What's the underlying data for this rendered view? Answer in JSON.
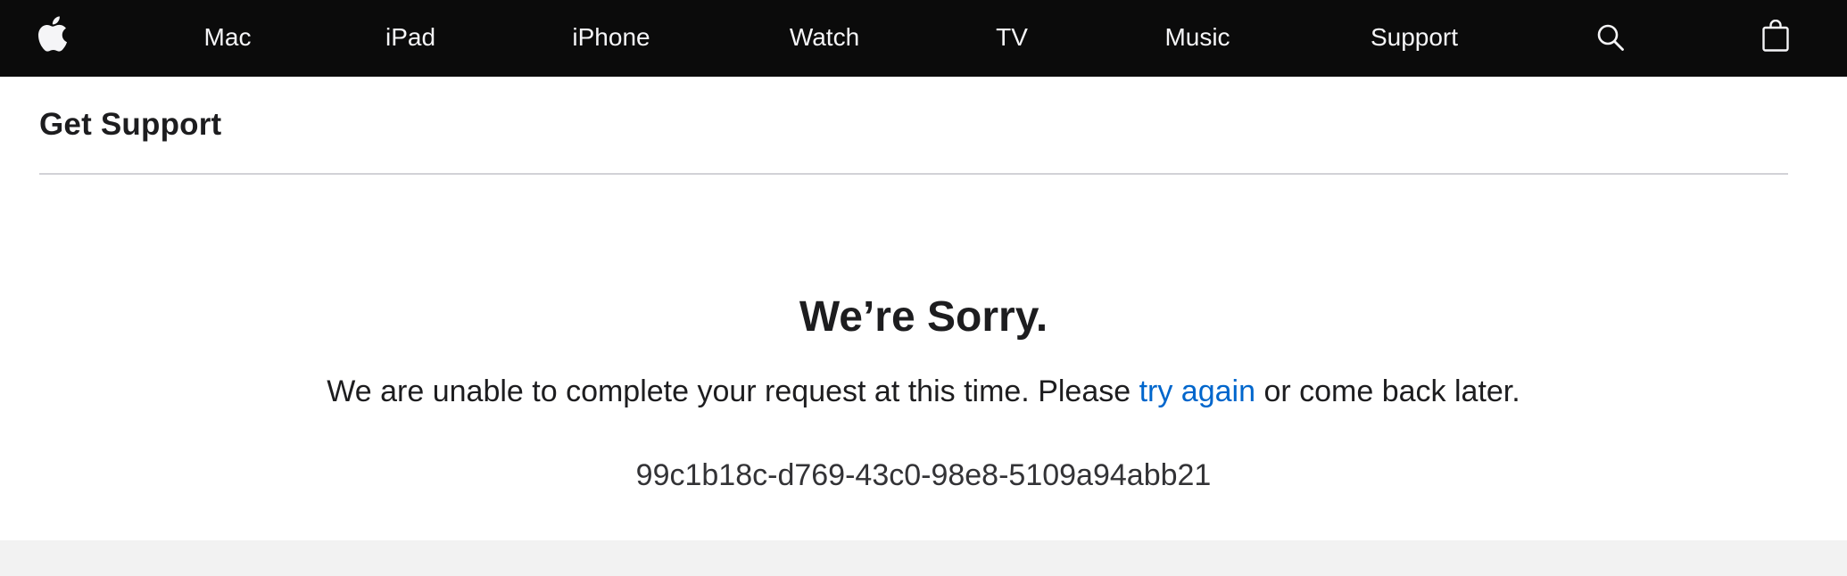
{
  "nav": {
    "items": [
      {
        "label": "Mac"
      },
      {
        "label": "iPad"
      },
      {
        "label": "iPhone"
      },
      {
        "label": "Watch"
      },
      {
        "label": "TV"
      },
      {
        "label": "Music"
      },
      {
        "label": "Support"
      }
    ],
    "icons": [
      "apple-logo-icon",
      "search-icon",
      "bag-icon"
    ],
    "background": "#0b0b0b",
    "text_color": "#f5f5f7"
  },
  "subnav": {
    "title": "Get Support"
  },
  "error": {
    "heading": "We’re Sorry.",
    "message_before": "We are unable to complete your request at this time. Please ",
    "link_text": "try again",
    "message_after": " or come back later.",
    "reference": "99c1b18c-d769-43c0-98e8-5109a94abb21",
    "link_color": "#0066cc"
  },
  "footer": {
    "background": "#f2f2f2"
  }
}
